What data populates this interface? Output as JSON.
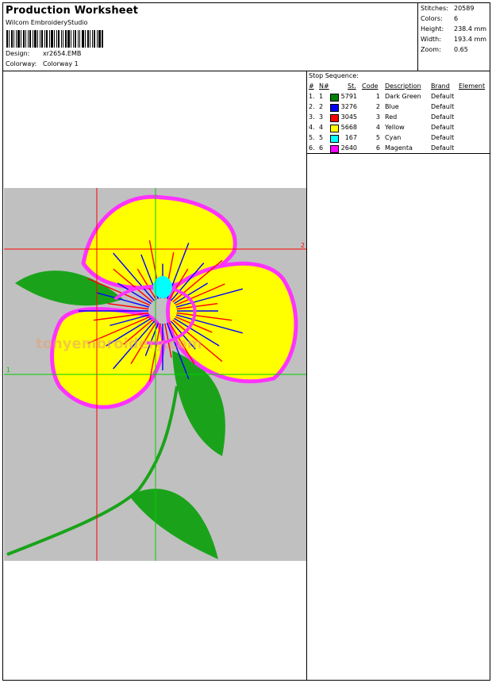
{
  "header": {
    "title": "Production Worksheet",
    "product": "Wilcom EmbroideryStudio",
    "design_label": "Design:",
    "design_value": "xr2654.EMB",
    "colorway_label": "Colorway:",
    "colorway_value": "Colorway 1"
  },
  "stats": [
    {
      "label": "Stitches:",
      "value": "20589"
    },
    {
      "label": "Colors:",
      "value": "6"
    },
    {
      "label": "Height:",
      "value": "238.4 mm"
    },
    {
      "label": "Width:",
      "value": "193.4 mm"
    },
    {
      "label": "Zoom:",
      "value": "0.65"
    }
  ],
  "stop_sequence": {
    "title": "Stop Sequence:",
    "headers": {
      "num": "#",
      "n": "N#",
      "st": "St.",
      "code": "Code",
      "description": "Description",
      "brand": "Brand",
      "element": "Element"
    },
    "rows": [
      {
        "num": "1.",
        "n": "1",
        "color": "#008000",
        "st": "5791",
        "code": "1",
        "description": "Dark Green",
        "brand": "Default"
      },
      {
        "num": "2.",
        "n": "2",
        "color": "#0000ff",
        "st": "3276",
        "code": "2",
        "description": "Blue",
        "brand": "Default"
      },
      {
        "num": "3.",
        "n": "3",
        "color": "#ff0000",
        "st": "3045",
        "code": "3",
        "description": "Red",
        "brand": "Default"
      },
      {
        "num": "4.",
        "n": "4",
        "color": "#ffff00",
        "st": "5668",
        "code": "4",
        "description": "Yellow",
        "brand": "Default"
      },
      {
        "num": "5.",
        "n": "5",
        "color": "#00ffff",
        "st": "167",
        "code": "5",
        "description": "Cyan",
        "brand": "Default"
      },
      {
        "num": "6.",
        "n": "6",
        "color": "#ff00ff",
        "st": "2640",
        "code": "6",
        "description": "Magenta",
        "brand": "Default"
      }
    ]
  },
  "design_view": {
    "background": "#c0c0c0",
    "guide_labels": {
      "h_top": "2",
      "h_mid": "1"
    },
    "watermark": "tonyembroidery.com",
    "colors": {
      "green": "#1aa31a",
      "blue": "#0000ff",
      "red": "#ff0000",
      "yellow": "#ffff00",
      "cyan": "#00ffff",
      "magenta": "#ff33ff",
      "guide_red": "#ff0000",
      "guide_green": "#00cc00"
    }
  }
}
